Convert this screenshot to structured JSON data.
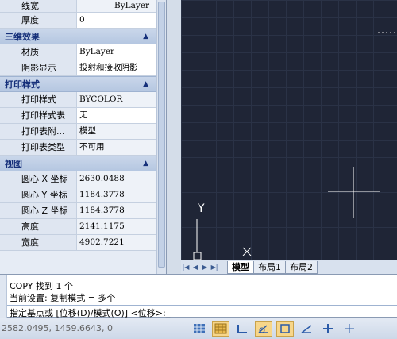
{
  "props": {
    "rows_top": [
      {
        "k": "线宽",
        "v": "ByLayer"
      },
      {
        "k": "厚度",
        "v": "0"
      }
    ],
    "sections": [
      {
        "title": "三维效果",
        "rows": [
          {
            "k": "材质",
            "v": "ByLayer"
          },
          {
            "k": "阴影显示",
            "v": "投射和接收阴影"
          }
        ]
      },
      {
        "title": "打印样式",
        "rows": [
          {
            "k": "打印样式",
            "v": "BYCOLOR"
          },
          {
            "k": "打印样式表",
            "v": "无"
          },
          {
            "k": "打印表附...",
            "v": "模型"
          },
          {
            "k": "打印表类型",
            "v": "不可用"
          }
        ]
      },
      {
        "title": "视图",
        "rows": [
          {
            "k": "圆心 X 坐标",
            "v": "2630.0488"
          },
          {
            "k": "圆心 Y 坐标",
            "v": "1184.3778"
          },
          {
            "k": "圆心 Z 坐标",
            "v": "1184.3778"
          },
          {
            "k": "高度",
            "v": "2141.1175"
          },
          {
            "k": "宽度",
            "v": "4902.7221"
          }
        ]
      }
    ],
    "collapse_glyph": "▲"
  },
  "canvas": {
    "ucs_y_label": "Y",
    "ucs_x_label": "X"
  },
  "tabs": [
    "模型",
    "布局1",
    "布局2"
  ],
  "nav_glyphs": [
    "|◀",
    "◀",
    "▶",
    "▶|"
  ],
  "command": {
    "line1": "COPY 找到 1 个",
    "line2": "当前设置:  复制模式 = 多个",
    "prompt": "指定基点或 [位移(D)/模式(O)] <位移>:",
    "caret": "_"
  },
  "status": {
    "coords": "2582.0495, 1459.6643, 0"
  },
  "colors": {
    "canvas_bg": "#1f2536",
    "section_text": "#16307a",
    "toggle_on": "#f7d68a"
  }
}
